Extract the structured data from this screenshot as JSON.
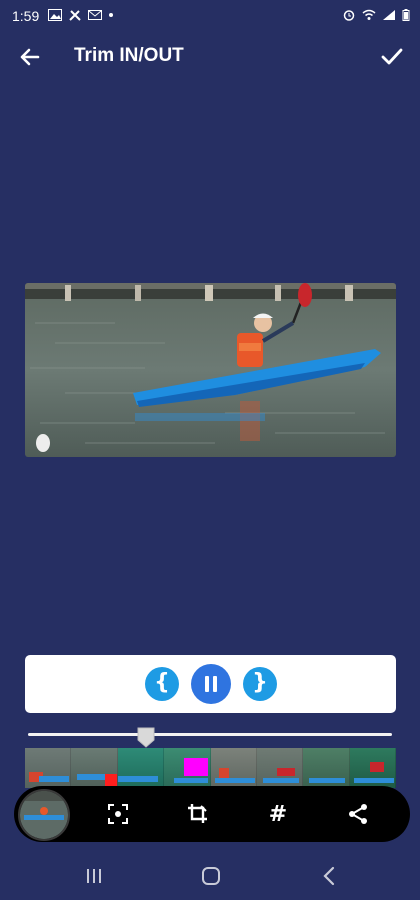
{
  "status_bar": {
    "time": "1:59",
    "left_icons": [
      "gallery-icon",
      "tools-icon",
      "mail-icon",
      "dot-icon"
    ],
    "right_icons": [
      "alarm-icon",
      "wifi-icon",
      "signal-icon",
      "battery-icon"
    ]
  },
  "app_bar": {
    "title": "Trim IN/OUT",
    "back_icon": "arrow-left-icon",
    "confirm_icon": "check-icon"
  },
  "video": {
    "description": "kayaker-on-water"
  },
  "controls": {
    "mark_in_label": "{",
    "mark_out_label": "}",
    "play_pause_icon": "pause-icon"
  },
  "timeline": {
    "position_fraction": 0.33,
    "frame_count": 8,
    "markers": [
      {
        "color": "#FF1E1E"
      },
      {
        "color": "#FF00FF"
      }
    ]
  },
  "toolbar": {
    "items": [
      "thumbnail",
      "screen-capture-icon",
      "crop-rotate-icon",
      "hashtag-icon",
      "share-icon"
    ],
    "hash_label": "#"
  },
  "nav_bar": {
    "items": [
      "recent-apps-icon",
      "home-icon",
      "back-icon"
    ]
  },
  "colors": {
    "background": "#262F63",
    "accent": "#1E9BE4",
    "play": "#2F74E0"
  }
}
